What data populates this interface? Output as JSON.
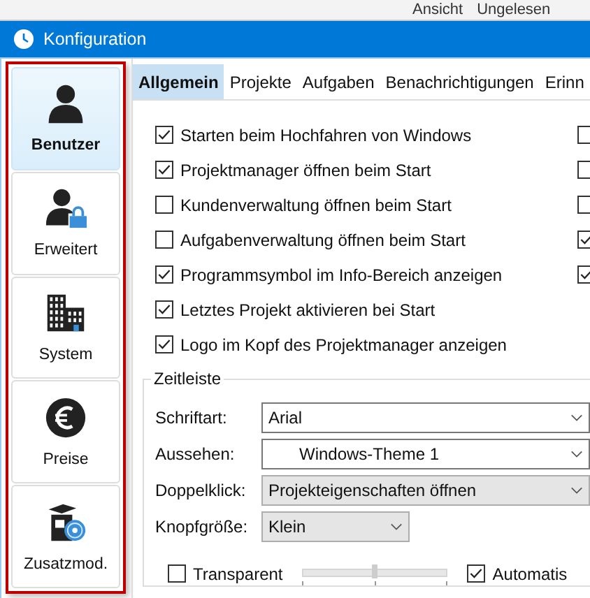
{
  "background_window": {
    "toolbar": [
      "Ansicht",
      "Ungelesen"
    ]
  },
  "window": {
    "title": "Konfiguration"
  },
  "sidebar": {
    "items": [
      {
        "label": "Benutzer",
        "selected": true
      },
      {
        "label": "Erweitert",
        "selected": false
      },
      {
        "label": "System",
        "selected": false
      },
      {
        "label": "Preise",
        "selected": false
      },
      {
        "label": "Zusatzmod.",
        "selected": false
      }
    ]
  },
  "tabs": [
    {
      "label": "Allgemein",
      "selected": true
    },
    {
      "label": "Projekte",
      "selected": false
    },
    {
      "label": "Aufgaben",
      "selected": false
    },
    {
      "label": "Benachrichtigungen",
      "selected": false
    },
    {
      "label": "Erinn",
      "selected": false
    }
  ],
  "options": [
    {
      "label": "Starten beim Hochfahren von Windows",
      "checked": true
    },
    {
      "label": "Projektmanager öffnen beim Start",
      "checked": true
    },
    {
      "label": "Kundenverwaltung öffnen beim Start",
      "checked": false
    },
    {
      "label": "Aufgabenverwaltung öffnen beim Start",
      "checked": false
    },
    {
      "label": "Programmsymbol im Info-Bereich anzeigen",
      "checked": true
    },
    {
      "label": "Letztes Projekt aktivieren bei Start",
      "checked": true
    },
    {
      "label": "Logo im Kopf des Projektmanager anzeigen",
      "checked": true
    }
  ],
  "options_column_2": [
    {
      "checked": false
    },
    {
      "checked": false
    },
    {
      "checked": false
    },
    {
      "checked": true
    },
    {
      "checked": true
    }
  ],
  "timeline": {
    "title": "Zeitleiste",
    "fields": [
      {
        "label": "Schriftart:",
        "value": "Arial",
        "kind": "editable",
        "indented": false
      },
      {
        "label": "Aussehen:",
        "value": "Windows-Theme 1",
        "kind": "editable",
        "indented": true
      },
      {
        "label": "Doppelklick:",
        "value": "Projekteigenschaften öffnen",
        "kind": "dropdown",
        "indented": false
      },
      {
        "label": "Knopfgröße:",
        "value": "Klein",
        "kind": "dropdown-short",
        "indented": false
      }
    ],
    "transparent": {
      "label": "Transparent",
      "checked": false
    },
    "opacity": {
      "level": 0.5
    },
    "auto": {
      "label": "Automatis",
      "checked": true
    }
  }
}
